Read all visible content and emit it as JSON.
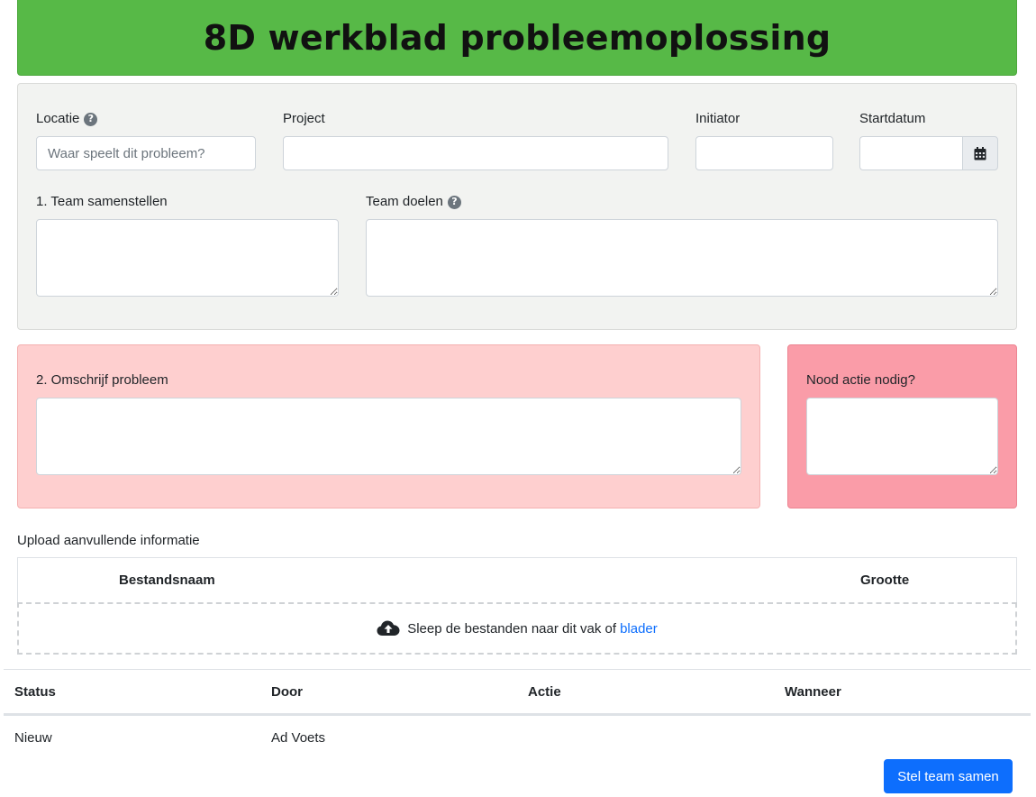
{
  "header": {
    "title": "8D werkblad probleemoplossing"
  },
  "form": {
    "locatie": {
      "label": "Locatie",
      "placeholder": "Waar speelt dit probleem?",
      "value": ""
    },
    "project": {
      "label": "Project",
      "value": ""
    },
    "initiator": {
      "label": "Initiator",
      "value": ""
    },
    "startdatum": {
      "label": "Startdatum",
      "value": ""
    },
    "team_samenstellen": {
      "label": "1. Team samenstellen",
      "value": ""
    },
    "team_doelen": {
      "label": "Team doelen",
      "value": ""
    },
    "omschrijf_probleem": {
      "label": "2. Omschrijf probleem",
      "value": ""
    },
    "nood_actie": {
      "label": "Nood actie nodig?",
      "value": ""
    }
  },
  "upload": {
    "title": "Upload aanvullende informatie",
    "columns": [
      "Bestandsnaam",
      "Grootte"
    ],
    "dropzone_text": "Sleep de bestanden naar dit vak of",
    "browse_link": "blader"
  },
  "history": {
    "columns": [
      "Status",
      "Door",
      "Actie",
      "Wanneer"
    ],
    "rows": [
      {
        "status": "Nieuw",
        "door": "Ad Voets",
        "actie": "",
        "wanneer": ""
      }
    ]
  },
  "actions": {
    "submit_label": "Stel team samen"
  },
  "icons": {
    "help": "question-circle-icon",
    "calendar": "calendar-icon",
    "upload": "cloud-upload-icon"
  },
  "colors": {
    "header": "#57b947",
    "panel_grey": "#f2f3f1",
    "panel_pink": "#fecfcf",
    "panel_red": "#fa9ca8",
    "primary": "#0d6efd"
  }
}
